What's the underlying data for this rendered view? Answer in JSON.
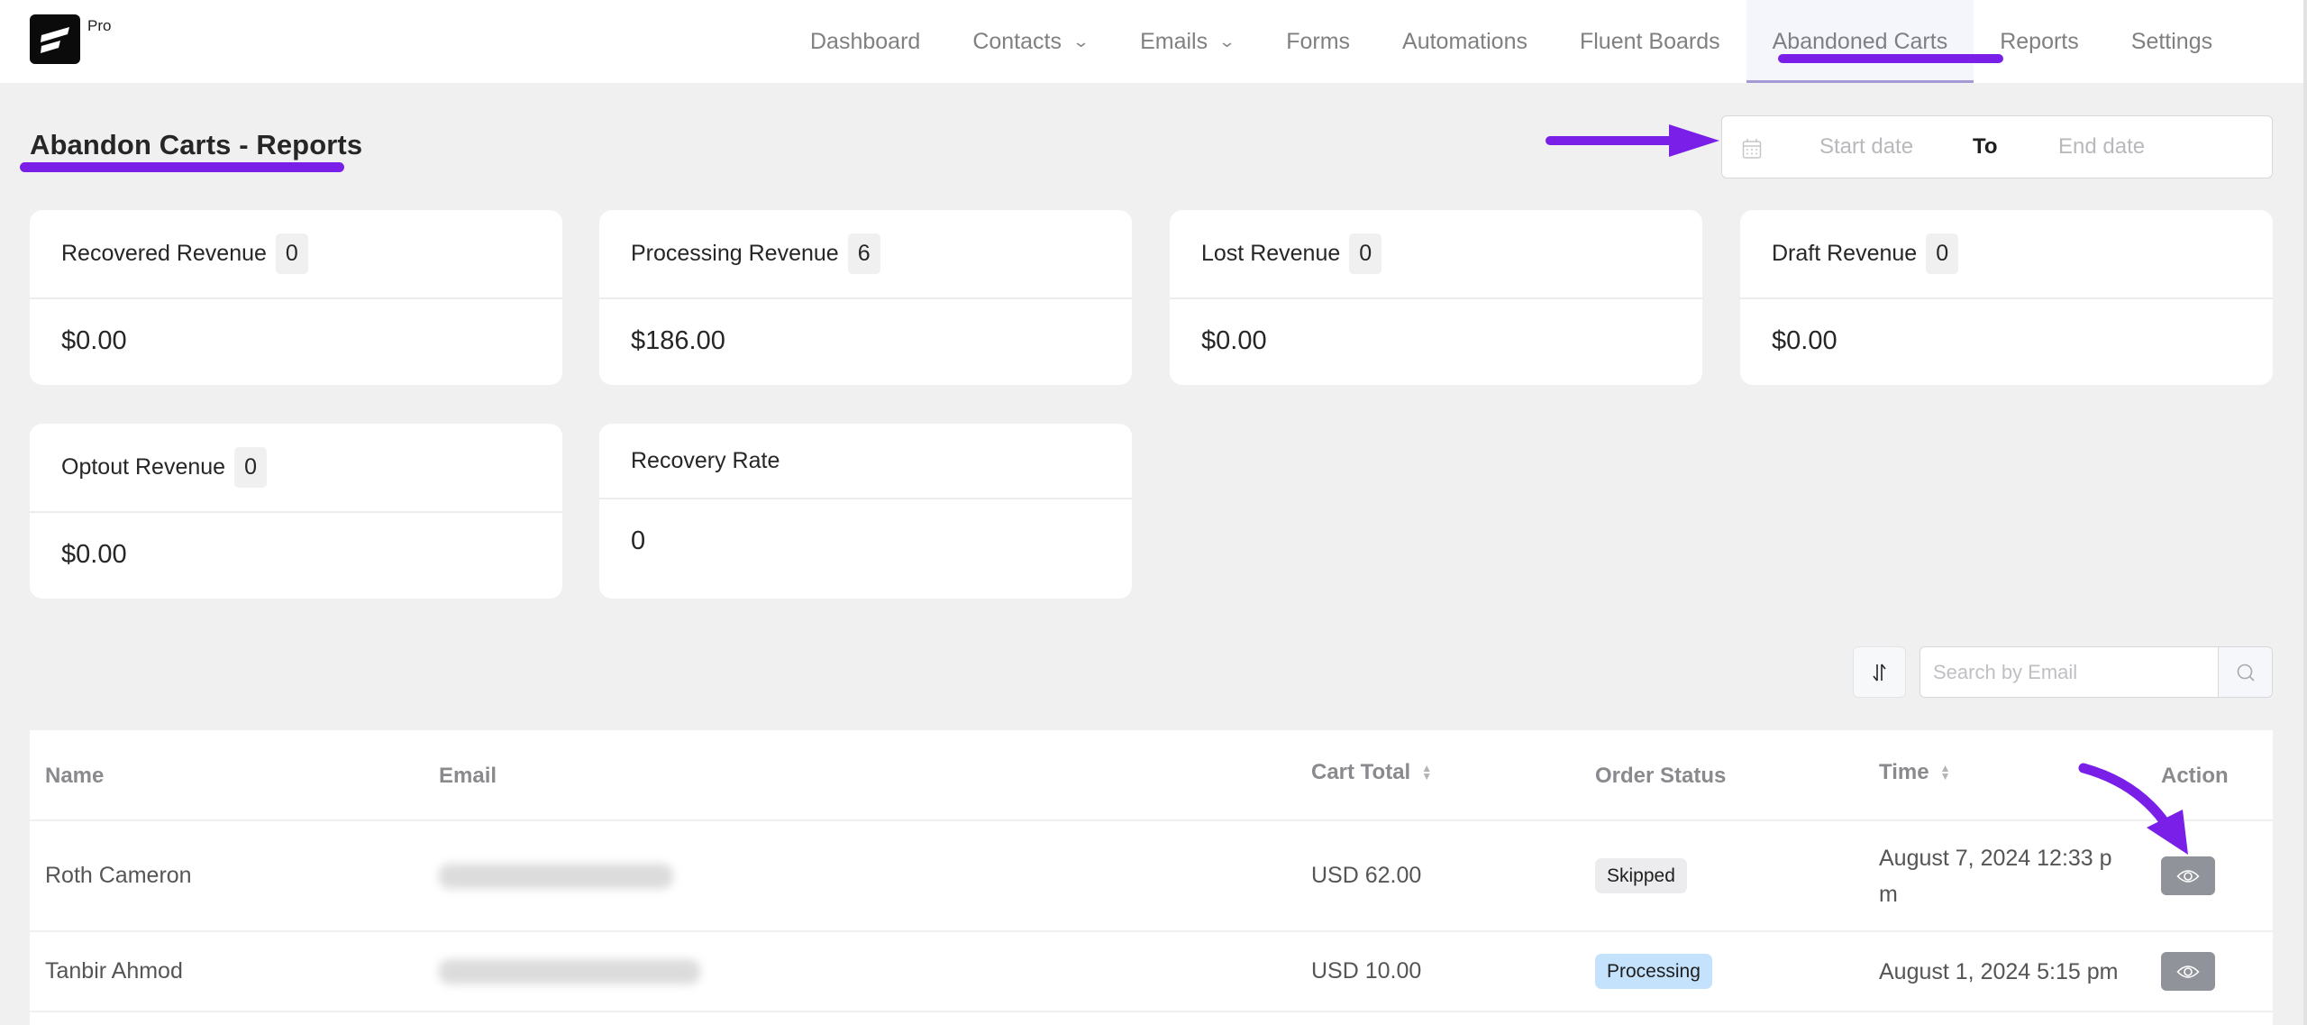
{
  "header": {
    "logo_badge": "Pro",
    "nav": [
      {
        "label": "Dashboard",
        "has_dropdown": false,
        "active": false
      },
      {
        "label": "Contacts",
        "has_dropdown": true,
        "active": false
      },
      {
        "label": "Emails",
        "has_dropdown": true,
        "active": false
      },
      {
        "label": "Forms",
        "has_dropdown": false,
        "active": false
      },
      {
        "label": "Automations",
        "has_dropdown": false,
        "active": false
      },
      {
        "label": "Fluent Boards",
        "has_dropdown": false,
        "active": false
      },
      {
        "label": "Abandoned Carts",
        "has_dropdown": false,
        "active": true
      },
      {
        "label": "Reports",
        "has_dropdown": false,
        "active": false
      },
      {
        "label": "Settings",
        "has_dropdown": false,
        "active": false
      }
    ],
    "dropdown_icon": "chevron-down-icon"
  },
  "page": {
    "title": "Abandon Carts - Reports"
  },
  "date_range": {
    "icon": "calendar-icon",
    "start_placeholder": "Start date",
    "separator": "To",
    "end_placeholder": "End date"
  },
  "stats": [
    {
      "label": "Recovered Revenue",
      "count": "0",
      "value": "$0.00"
    },
    {
      "label": "Processing Revenue",
      "count": "6",
      "value": "$186.00"
    },
    {
      "label": "Lost Revenue",
      "count": "0",
      "value": "$0.00"
    },
    {
      "label": "Draft Revenue",
      "count": "0",
      "value": "$0.00"
    },
    {
      "label": "Optout Revenue",
      "count": "0",
      "value": "$0.00"
    },
    {
      "label": "Recovery Rate",
      "count": null,
      "value": "0"
    }
  ],
  "toolbar": {
    "sort_icon": "sort-toggle-icon",
    "search_placeholder": "Search by Email",
    "search_value": "",
    "search_icon": "search-icon"
  },
  "table": {
    "columns": [
      {
        "label": "Name",
        "sortable": false
      },
      {
        "label": "Email",
        "sortable": false
      },
      {
        "label": "Cart Total",
        "sortable": true
      },
      {
        "label": "Order Status",
        "sortable": false
      },
      {
        "label": "Time",
        "sortable": true
      },
      {
        "label": "Action",
        "sortable": false
      }
    ],
    "rows": [
      {
        "name": "Roth Cameron",
        "email": "(blurred)",
        "cart_total": "USD 62.00",
        "status": "Skipped",
        "status_type": "skipped",
        "time": "August 7, 2024 12:33 pm",
        "action_icon": "eye-icon"
      },
      {
        "name": "Tanbir Ahmod",
        "email": "(blurred)",
        "cart_total": "USD 10.00",
        "status": "Processing",
        "status_type": "processing",
        "time": "August 1, 2024 5:15 pm",
        "action_icon": "eye-icon"
      }
    ]
  },
  "colors": {
    "annotation": "#7a1fe8",
    "page_bg": "#f0f0f1",
    "processing_badge": "#c4e2fb",
    "skipped_badge": "#ececee",
    "action_button": "#909399"
  }
}
